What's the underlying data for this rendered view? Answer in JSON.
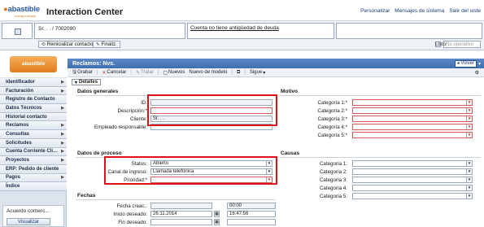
{
  "header": {
    "logo_text": "abastible",
    "logo_tagline": "energía simple",
    "app_title": "Interaction Center",
    "links": [
      "Personalizar",
      "Mensajes de sistema",
      "Salir del siste"
    ]
  },
  "context": {
    "account": "Sr. . . / 7002090",
    "note": "Cuenta no tiene antigüedad de deuda",
    "reset_button": "Reinicializar contacto",
    "finish_button": "Finaliz.",
    "list_label": "Listo:",
    "list_value": "No operativo"
  },
  "sidebar": {
    "logo_text": "abastible",
    "items": [
      {
        "label": "Identificador",
        "arrow": true
      },
      {
        "label": "Facturación",
        "arrow": true
      },
      {
        "label": "Registro de Contacto",
        "arrow": false
      },
      {
        "label": "Datos Técnicos",
        "arrow": true
      },
      {
        "label": "Historial contacto",
        "arrow": false
      },
      {
        "label": "Reclamos",
        "arrow": true
      },
      {
        "label": "Consultas",
        "arrow": true
      },
      {
        "label": "Solicitudes",
        "arrow": true
      },
      {
        "label": "Cuenta Corriente Cli...",
        "arrow": true
      },
      {
        "label": "Proyectos",
        "arrow": true
      },
      {
        "label": "ERP: Pedido de cliente",
        "arrow": false
      },
      {
        "label": "Pagos",
        "arrow": true
      },
      {
        "label": "Índice",
        "arrow": false
      }
    ],
    "panel_title": "Acuerdo comerc...",
    "panel_button": "Visualizar"
  },
  "main": {
    "title": "Reclamos: Nvs.",
    "back_label": "Volver",
    "toolbar": {
      "save": "Grabar",
      "cancel": "Cancelar",
      "process": "Tratar",
      "new": "Nuevos",
      "new_template": "Nuevo de modelo",
      "next": "Sigue"
    },
    "details_tab": "Detalles",
    "general": {
      "title": "Datos generales",
      "id_label": "ID:",
      "desc_label": "Descripción:*",
      "client_label": "Cliente:",
      "client_value": "Sr. . .",
      "emp_label": "Empleado responsable:"
    },
    "motivo": {
      "title": "Motivo",
      "cat1": "Categoría 1:*",
      "cat2": "Categoría 2:*",
      "cat3": "Categoría 3:*",
      "cat4": "Categoría 4:*",
      "cat5": "Categoría 5:*"
    },
    "process": {
      "title": "Datos de proceso",
      "status_label": "Status:",
      "status_value": "Abierto",
      "channel_label": "Canal de ingreso:",
      "channel_value": "Llamada telefónica",
      "priority_label": "Prioridad:*"
    },
    "causas": {
      "title": "Causas",
      "cat1": "Categoría 1:",
      "cat2": "Categoría 2:",
      "cat3": "Categoría 3:",
      "cat4": "Categoría 4:",
      "cat5": "Categoría 5:"
    },
    "fechas": {
      "title": "Fechas",
      "created_label": "Fecha creac.:",
      "created_time": "00:00",
      "start_label": "Inicio deseado:",
      "start_date": "26.11.2014",
      "start_time": "16:47:56",
      "end_label": "Fin deseado:"
    }
  },
  "colors": {
    "accent": "#3f6eb0",
    "highlight": "#e0101a",
    "required_border": "#d35a5a"
  }
}
